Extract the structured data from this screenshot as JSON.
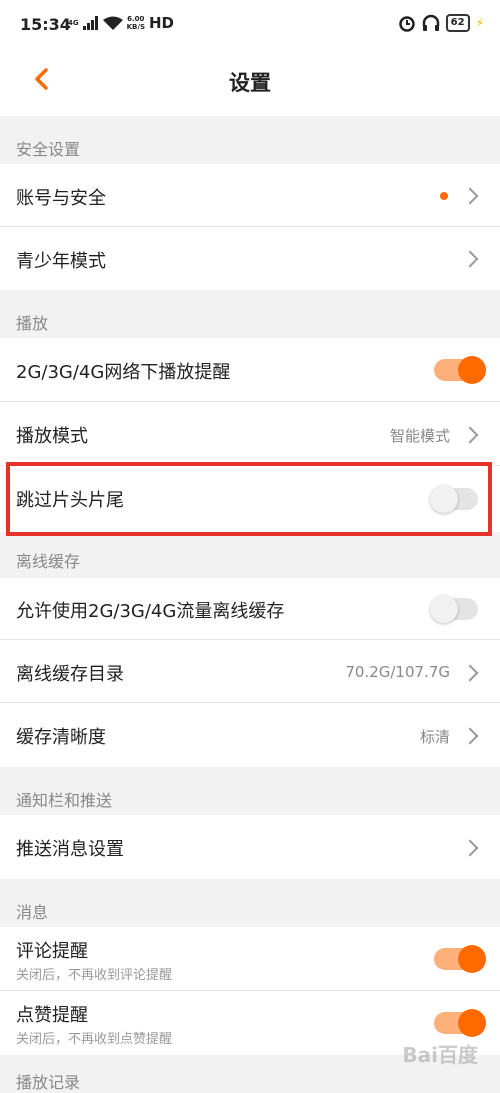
{
  "status_bar": {
    "time": "15:34",
    "network_small": "4G",
    "speed_value": "6.00",
    "speed_unit": "KB/S",
    "hd": "HD",
    "battery": "62"
  },
  "nav": {
    "title": "设置"
  },
  "sections": {
    "security": {
      "header": "安全设置",
      "account": "账号与安全",
      "teen": "青少年模式"
    },
    "playback": {
      "header": "播放",
      "network_reminder": "2G/3G/4G网络下播放提醒",
      "mode_label": "播放模式",
      "mode_value": "智能模式",
      "skip": "跳过片头片尾"
    },
    "offline": {
      "header": "离线缓存",
      "allow": "允许使用2G/3G/4G流量离线缓存",
      "dir_label": "离线缓存目录",
      "dir_value": "70.2G/107.7G",
      "quality_label": "缓存清晰度",
      "quality_value": "标清"
    },
    "notify": {
      "header": "通知栏和推送",
      "push": "推送消息设置"
    },
    "messages": {
      "header": "消息",
      "comment": "评论提醒",
      "comment_sub": "关闭后，不再收到评论提醒",
      "like": "点赞提醒",
      "like_sub": "关闭后，不再收到点赞提醒"
    },
    "history": {
      "header": "播放记录"
    }
  },
  "toggles": {
    "network_reminder": true,
    "skip": false,
    "allow_offline": false,
    "comment": true,
    "like": true
  },
  "colors": {
    "accent": "#ff6a00",
    "highlight_box": "#e5332a"
  },
  "watermark": "Bai百度"
}
